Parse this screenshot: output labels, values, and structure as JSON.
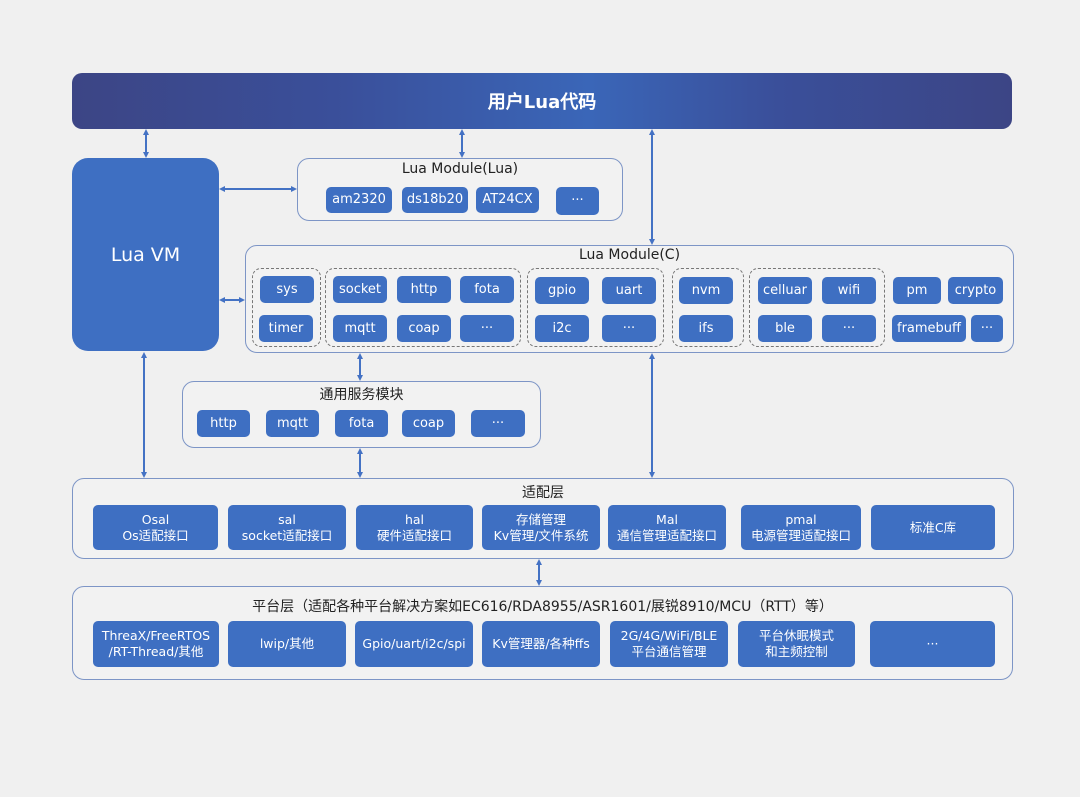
{
  "header": {
    "title": "用户Lua代码"
  },
  "lua_vm": {
    "label": "Lua VM"
  },
  "lua_module_lua": {
    "title": "Lua Module(Lua)",
    "items": [
      "am2320",
      "ds18b20",
      "AT24CX",
      "···"
    ]
  },
  "lua_module_c": {
    "title": "Lua Module(C)",
    "groups": [
      {
        "items": [
          "sys",
          "timer"
        ]
      },
      {
        "items": [
          "socket",
          "http",
          "fota",
          "mqtt",
          "coap",
          "···"
        ]
      },
      {
        "items": [
          "gpio",
          "uart",
          "i2c",
          "···"
        ]
      },
      {
        "items": [
          "nvm",
          "ifs"
        ]
      },
      {
        "items": [
          "celluar",
          "wifi",
          "ble",
          "···"
        ]
      }
    ],
    "ungrouped": [
      "pm",
      "crypto",
      "framebuff",
      "···"
    ]
  },
  "common_services": {
    "title": "通用服务模块",
    "items": [
      "http",
      "mqtt",
      "fota",
      "coap",
      "···"
    ]
  },
  "adapter_layer": {
    "title": "适配层",
    "items": [
      {
        "line1": "Osal",
        "line2": "Os适配接口"
      },
      {
        "line1": "sal",
        "line2": "socket适配接口"
      },
      {
        "line1": "hal",
        "line2": "硬件适配接口"
      },
      {
        "line1": "存储管理",
        "line2": "Kv管理/文件系统"
      },
      {
        "line1": "Mal",
        "line2": "通信管理适配接口"
      },
      {
        "line1": "pmal",
        "line2": "电源管理适配接口"
      },
      {
        "line1": "标准C库",
        "line2": ""
      }
    ]
  },
  "platform_layer": {
    "title": "平台层（适配各种平台解决方案如EC616/RDA8955/ASR1601/展锐8910/MCU（RTT）等）",
    "items": [
      {
        "line1": "ThreaX/FreeRTOS",
        "line2": "/RT-Thread/其他"
      },
      {
        "line1": "lwip/其他",
        "line2": ""
      },
      {
        "line1": "Gpio/uart/i2c/spi",
        "line2": ""
      },
      {
        "line1": "Kv管理器/各种ffs",
        "line2": ""
      },
      {
        "line1": "2G/4G/WiFi/BLE",
        "line2": "平台通信管理"
      },
      {
        "line1": "平台休眠模式",
        "line2": "和主频控制"
      },
      {
        "line1": "···",
        "line2": ""
      }
    ]
  },
  "colors": {
    "block": "#3e6fc2",
    "arrow": "#4472c4",
    "panel_border": "#7d95c6",
    "background": "#f0f0f0"
  }
}
